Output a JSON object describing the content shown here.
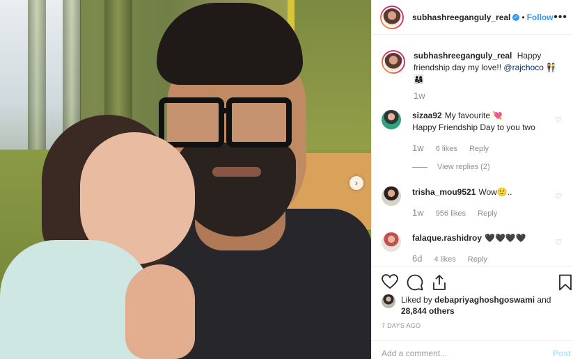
{
  "header": {
    "username": "subhashreeganguly_real",
    "separator": "•",
    "follow_label": "Follow",
    "more_label": "•••"
  },
  "caption": {
    "username": "subhashreeganguly_real",
    "text": "Happy friendship day my love!!",
    "mention": "@rajchoco",
    "emoji": "👫 👨‍👩‍👧",
    "time": "1w"
  },
  "comments": [
    {
      "username": "sizaa92",
      "text": "My favourite 💘",
      "text2": "Happy Friendship Day to you two",
      "time": "1w",
      "likes": "6 likes",
      "reply": "Reply",
      "view_replies": "View replies (2)"
    },
    {
      "username": "trisha_mou9521",
      "text": "Wow🙂..",
      "time": "1w",
      "likes": "956 likes",
      "reply": "Reply"
    },
    {
      "username": "falaque.rashidroy",
      "text": "🖤🖤🖤🖤",
      "time": "6d",
      "likes": "4 likes",
      "reply": "Reply"
    }
  ],
  "icons": {
    "like": "heart-icon",
    "comment": "comment-icon",
    "share": "share-icon",
    "save": "bookmark-icon",
    "comment_like": "heart-icon",
    "next": "chevron-right-icon"
  },
  "likes": {
    "prefix": "Liked by",
    "user": "debapriyaghoshgoswami",
    "middle": "and",
    "others": "28,844 others"
  },
  "date": "7 DAYS AGO",
  "add_comment": {
    "placeholder": "Add a comment...",
    "post_label": "Post"
  },
  "colors": {
    "accent": "#3897f0",
    "muted": "#8e8e8e",
    "text": "#262626"
  }
}
